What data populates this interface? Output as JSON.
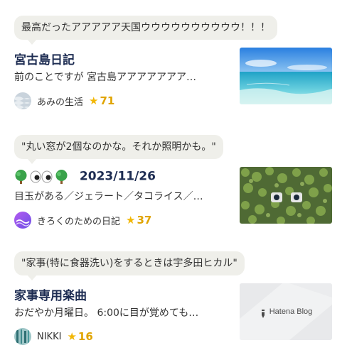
{
  "entries": [
    {
      "quote": "最高だったアアアアア天国ウウウウウウウウウウ！！！",
      "title": "宮古島日記",
      "excerpt": "前のことですが 宮古島アアアアアアア…",
      "blog_name": "あみの生活",
      "stars": "71",
      "thumbnail": "beach-photo"
    },
    {
      "quote": "\"丸い窓が2個なのかな。それか照明かも。\"",
      "title_emoji": [
        "tree-icon",
        "eyes-icon",
        "tree-icon"
      ],
      "title": "2023/11/26",
      "excerpt": "目玉がある／ジェラート／タコライス／…",
      "blog_name": "きろくのための日記",
      "stars": "37",
      "thumbnail": "ivy-wall-photo"
    },
    {
      "quote": "\"家事(特に食器洗い)をするときは宇多田ヒカル\"",
      "title": "家事専用楽曲",
      "excerpt": "おだやか月曜日。 6:00に目が覚めても…",
      "blog_name": "NIKKI",
      "stars": "16",
      "thumbnail": "hatena-blog-placeholder",
      "thumbnail_text": "Hatena Blog"
    }
  ],
  "star_symbol": "★",
  "colors": {
    "title": "#1d2c52",
    "bubble": "#efefea",
    "star": "#f2b705"
  }
}
